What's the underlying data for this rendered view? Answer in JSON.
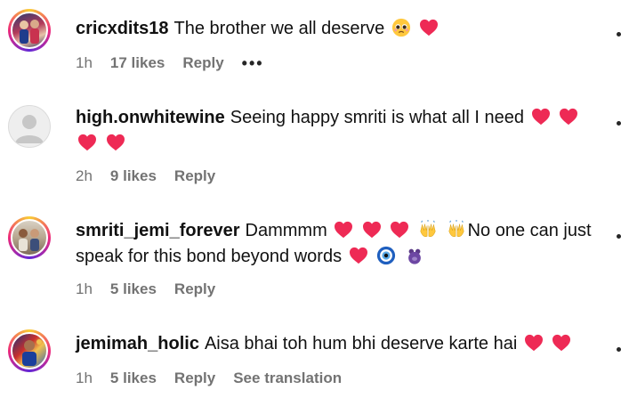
{
  "comments": [
    {
      "username": "cricxdits18",
      "text": "The brother we all deserve",
      "time": "1h",
      "likes": "17 likes",
      "reply": "Reply",
      "more": "•••"
    },
    {
      "username": "high.onwhitewine",
      "text": "Seeing happy smriti is what all I need",
      "time": "2h",
      "likes": "9 likes",
      "reply": "Reply"
    },
    {
      "username": "smriti_jemi_forever",
      "text_a": "Dammmm",
      "text_b": "No one can just speak for this bond beyond words",
      "time": "1h",
      "likes": "5 likes",
      "reply": "Reply"
    },
    {
      "username": "jemimah_holic",
      "text": "Aisa bhai toh hum bhi deserve karte hai",
      "time": "1h",
      "likes": "5 likes",
      "reply": "Reply",
      "translate": "See translation"
    }
  ],
  "icons": {
    "heart": "heart-icon",
    "pleading": "pleading-face-icon",
    "raised_hands": "raising-hands-icon",
    "nazar": "nazar-amulet-icon",
    "bear": "bear-icon",
    "more": "more-options-icon",
    "like": "like-icon"
  },
  "colors": {
    "heart": "#ee2a55",
    "meta_text": "#737373",
    "username": "#111111"
  }
}
